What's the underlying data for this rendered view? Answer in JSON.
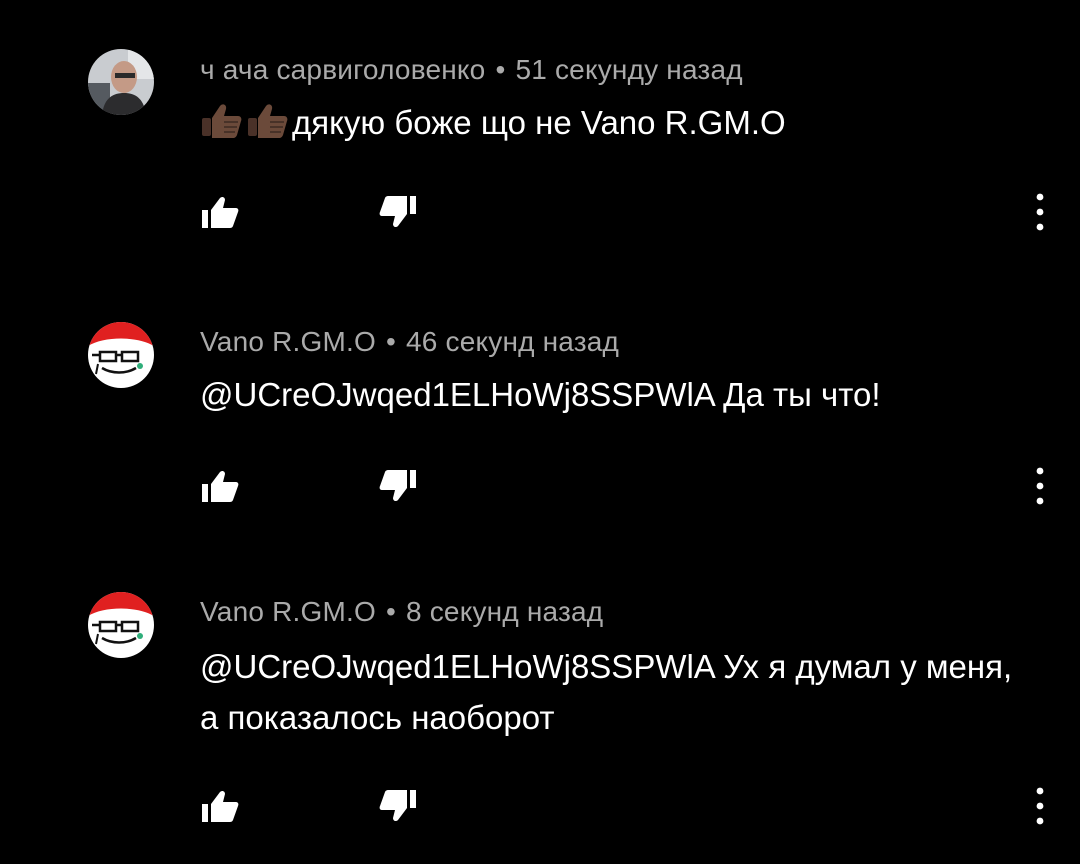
{
  "comments": [
    {
      "author": "ч ача сарвиголовенко",
      "separator": "•",
      "time": "51 секунду назад",
      "emoji": "thumbs-up-emoji",
      "text": "дякую боже що не Vano R.GM.O",
      "avatar": "photo-avatar"
    },
    {
      "author": "Vano R.GM.O",
      "separator": "•",
      "time": "46 секунд назад",
      "text": "@UCreOJwqed1ELHoWj8SSPWlA Да ты что!",
      "avatar": "santa-hat-face-avatar"
    },
    {
      "author": "Vano R.GM.O",
      "separator": "•",
      "time": "8 секунд назад",
      "text": "@UCreOJwqed1ELHoWj8SSPWlA Ух я думал у меня, а показалось наоборот",
      "avatar": "santa-hat-face-avatar"
    }
  ],
  "icons": {
    "like": "thumbs-up-icon",
    "dislike": "thumbs-down-icon",
    "more": "more-vertical-icon"
  },
  "colors": {
    "background": "#000000",
    "meta_text": "#aaaaaa",
    "body_text": "#ffffff",
    "icon": "#ffffff",
    "emoji_skin": "#6b4a3a"
  }
}
